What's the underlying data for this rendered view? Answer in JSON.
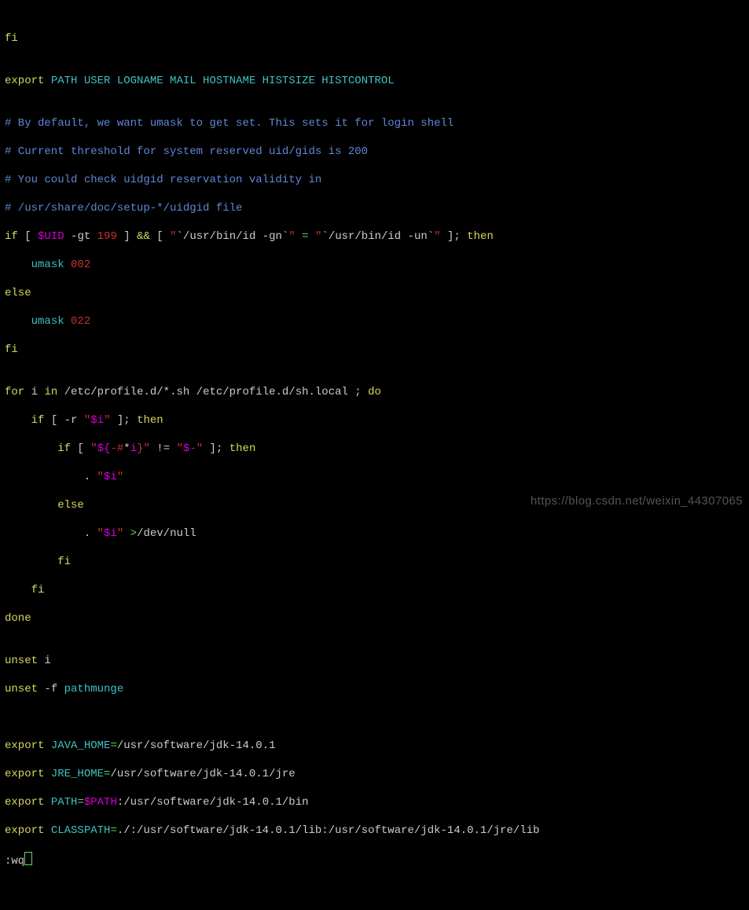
{
  "lines": {
    "l1_fi": "fi",
    "l2_blank": "",
    "l3_export": "export",
    "l3_vars": " PATH USER LOGNAME MAIL HOSTNAME HISTSIZE HISTCONTROL",
    "l4_blank": "",
    "l5_c": "# By default, we want umask to get set. This sets it for login shell",
    "l6_c": "# Current threshold for system reserved uid/gids is 200",
    "l7_c": "# You could check uidgid reservation validity in",
    "l8_c": "# /usr/share/doc/setup-*/uidgid file",
    "l9_if": "if",
    "l9_br1": " [ ",
    "l9_uid": "$UID",
    "l9_gt": " -gt ",
    "l9_199": "199",
    "l9_br2": " ] ",
    "l9_and": "&&",
    "l9_br3": " [ ",
    "l9_q1a": "\"",
    "l9_cmd1": "`/usr/bin/id -gn`",
    "l9_q1b": "\"",
    "l9_eq": " = ",
    "l9_q2a": "\"",
    "l9_cmd2": "`/usr/bin/id -un`",
    "l9_q2b": "\"",
    "l9_br4": " ]; ",
    "l9_then": "then",
    "l10_pad": "    ",
    "l10_umask": "umask",
    "l10_sp": " ",
    "l10_002": "002",
    "l11_else": "else",
    "l12_pad": "    ",
    "l12_umask": "umask",
    "l12_sp": " ",
    "l12_022": "022",
    "l13_fi": "fi",
    "l14_blank": "",
    "l15_for": "for",
    "l15_i": " i ",
    "l15_in": "in",
    "l15_glob": " /etc/profile.d/*.sh /etc/profile.d/sh.local ; ",
    "l15_do": "do",
    "l16_pad": "    ",
    "l16_if": "if",
    "l16_br1": " [ -r ",
    "l16_q1": "\"",
    "l16_i": "$i",
    "l16_q2": "\"",
    "l16_br2": " ]; ",
    "l16_then": "then",
    "l17_pad": "        ",
    "l17_if": "if",
    "l17_br1": " [ ",
    "l17_q1": "\"",
    "l17_exp_open": "${",
    "l17_dash_hash": "-#",
    "l17_star": "*",
    "l17_ivar": "i",
    "l17_close_q": "}\"",
    "l17_neq": " != ",
    "l17_q2a": "\"",
    "l17_dollar_dash": "$-",
    "l17_q2b": "\"",
    "l17_br2": " ]; ",
    "l17_then": "then",
    "l18_pad": "            . ",
    "l18_q1": "\"",
    "l18_i": "$i",
    "l18_q2": "\"",
    "l19_pad": "        ",
    "l19_else": "else",
    "l20_pad": "            . ",
    "l20_q1": "\"",
    "l20_i": "$i",
    "l20_q2": "\"",
    "l20_gt": " >",
    "l20_devnull": "/dev/null",
    "l21_pad": "        ",
    "l21_fi": "fi",
    "l22_pad": "    ",
    "l22_fi": "fi",
    "l23_done": "done",
    "l24_blank": "",
    "l25_unset": "unset",
    "l25_i": " i",
    "l26_unset": "unset",
    "l26_f": " -f ",
    "l26_pm": "pathmunge",
    "l27_blank": "",
    "l28_blank": "",
    "l29_export": "export",
    "l29_var": " JAVA_HOME",
    "l29_eq": "=",
    "l29_val": "/usr/software/jdk-14.0.1",
    "l30_export": "export",
    "l30_var": " JRE_HOME",
    "l30_eq": "=",
    "l30_val": "/usr/software/jdk-14.0.1/jre",
    "l31_export": "export",
    "l31_var": " PATH",
    "l31_eq": "=",
    "l31_path": "$PATH",
    "l31_val": ":/usr/software/jdk-14.0.1/bin",
    "l32_export": "export",
    "l32_var": " CLASSPATH",
    "l32_eq": "=",
    "l32_val": "./:/usr/software/jdk-14.0.1/lib:/usr/software/jdk-14.0.1/jre/lib",
    "l33_wq": ":wq"
  },
  "watermark": "https://blog.csdn.net/weixin_44307065"
}
